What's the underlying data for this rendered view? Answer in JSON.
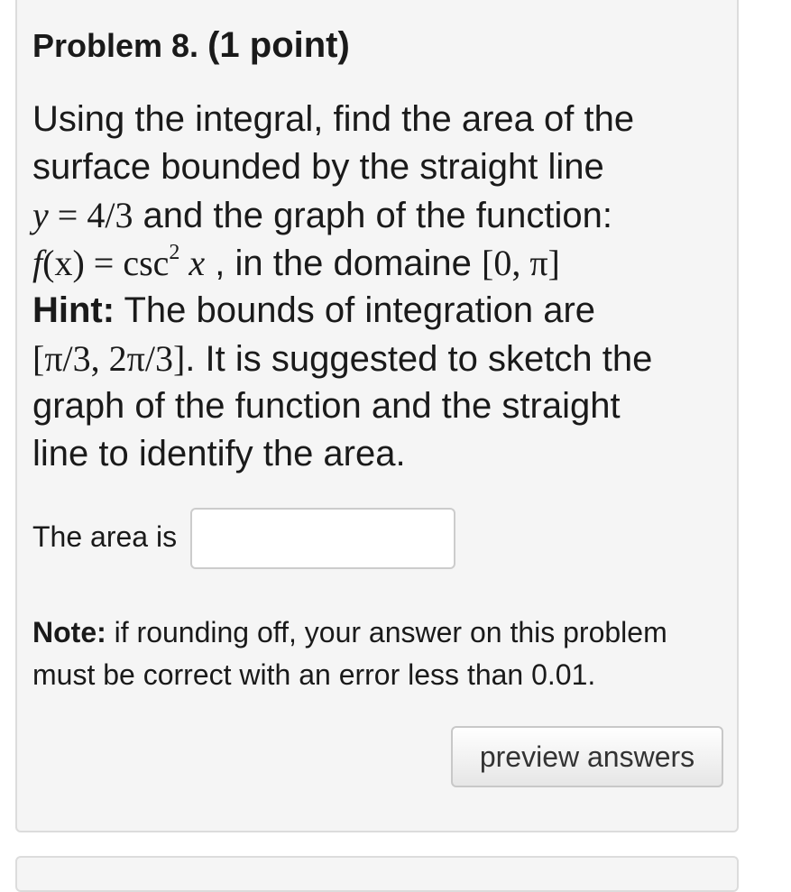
{
  "problem": {
    "title": "Problem 8.",
    "points": "(1 point)",
    "statement": {
      "line1": "Using the integral, find the area of the",
      "line2": "surface bounded by the straight line",
      "eq1_lhs": "y",
      "eq1_op": " = 4/3",
      "line3_rest": " and the graph of the function:",
      "func_f": "f",
      "func_args": "(x) = csc",
      "func_exp": "2",
      "func_x": " x",
      "line4_rest": " , in the domaine ",
      "domain": "[0, π]",
      "hint_label": "Hint:",
      "hint_text": " The bounds of integration are",
      "bounds": "[π/3, 2π/3]",
      "line6_rest": ". It is suggested to sketch the",
      "line7": "graph of the function and the straight",
      "line8": "line to identify the area."
    },
    "answer": {
      "label": "The area is",
      "value": "",
      "placeholder": ""
    },
    "note": {
      "label": "Note:",
      "text1": " if rounding off, your answer on this problem",
      "text2": "must be correct with an error less than 0.01."
    },
    "preview_label": "preview answers"
  }
}
